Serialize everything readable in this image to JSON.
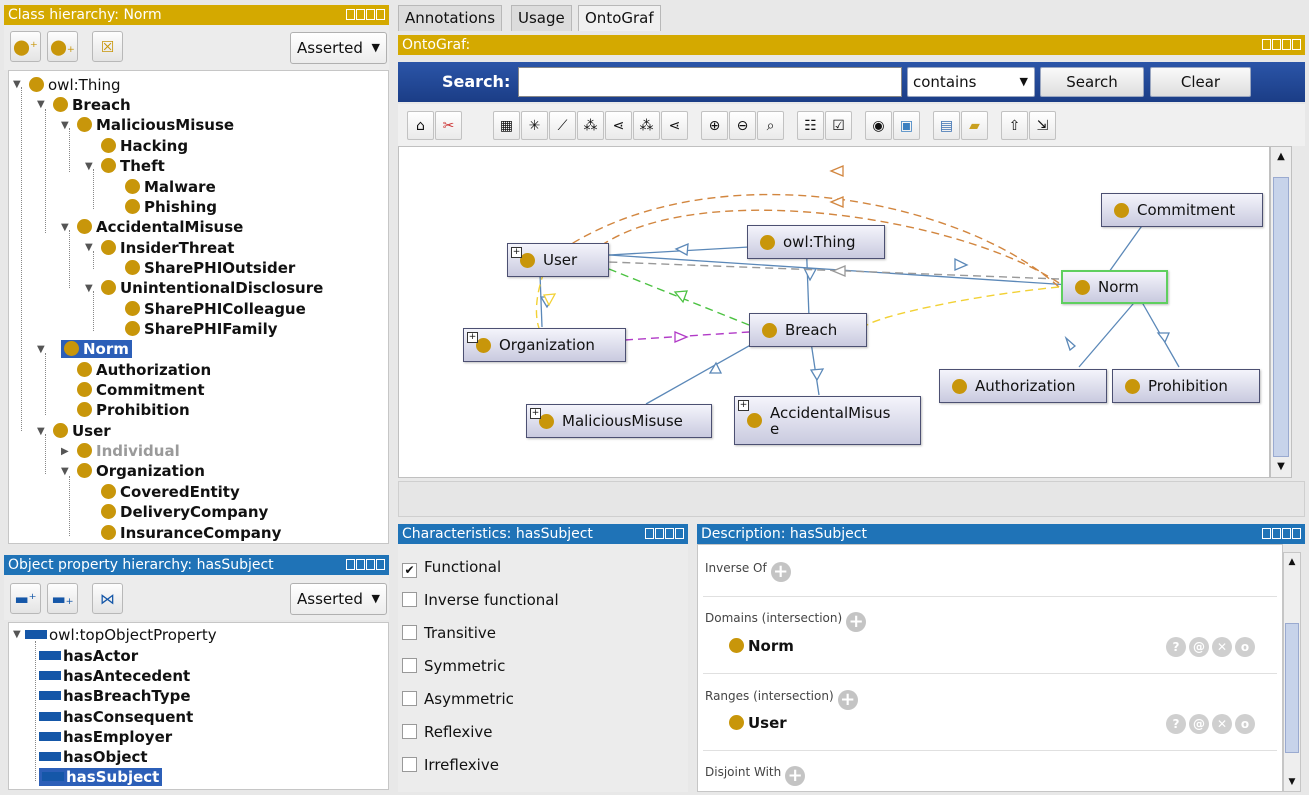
{
  "class_panel": {
    "title": "Class hierarchy: Norm",
    "mode": "Asserted",
    "tree": [
      {
        "label": "owl:Thing",
        "selected": false
      },
      {
        "label": "Breach",
        "selected": false
      },
      {
        "label": "MaliciousMisuse",
        "selected": false
      },
      {
        "label": "Hacking",
        "selected": false
      },
      {
        "label": "Theft",
        "selected": false
      },
      {
        "label": "Malware",
        "selected": false
      },
      {
        "label": "Phishing",
        "selected": false
      },
      {
        "label": "AccidentalMisuse",
        "selected": false
      },
      {
        "label": "InsiderThreat",
        "selected": false
      },
      {
        "label": "SharePHIOutsider",
        "selected": false
      },
      {
        "label": "UnintentionalDisclosure",
        "selected": false
      },
      {
        "label": "SharePHIColleague",
        "selected": false
      },
      {
        "label": "SharePHIFamily",
        "selected": false
      },
      {
        "label": "Norm",
        "selected": true
      },
      {
        "label": "Authorization",
        "selected": false
      },
      {
        "label": "Commitment",
        "selected": false
      },
      {
        "label": "Prohibition",
        "selected": false
      },
      {
        "label": "User",
        "selected": false
      },
      {
        "label": "Individual",
        "selected": false
      },
      {
        "label": "Organization",
        "selected": false
      },
      {
        "label": "CoveredEntity",
        "selected": false
      },
      {
        "label": "DeliveryCompany",
        "selected": false
      },
      {
        "label": "InsuranceCompany",
        "selected": false
      }
    ]
  },
  "property_panel": {
    "title": "Object property hierarchy: hasSubject",
    "mode": "Asserted",
    "tree": [
      {
        "label": "owl:topObjectProperty"
      },
      {
        "label": "hasActor"
      },
      {
        "label": "hasAntecedent"
      },
      {
        "label": "hasBreachType"
      },
      {
        "label": "hasConsequent"
      },
      {
        "label": "hasEmployer"
      },
      {
        "label": "hasObject"
      },
      {
        "label": "hasSubject"
      }
    ]
  },
  "tabs": [
    "Annotations",
    "Usage",
    "OntoGraf"
  ],
  "ontograf": {
    "title": "OntoGraf:",
    "search_label": "Search:",
    "search_value": "",
    "match_mode": "contains",
    "search_button": "Search",
    "clear_button": "Clear",
    "nodes": {
      "owl_thing": "owl:Thing",
      "user": "User",
      "commitment": "Commitment",
      "norm": "Norm",
      "organization": "Organization",
      "breach": "Breach",
      "authorization": "Authorization",
      "prohibition": "Prohibition",
      "malicious": "MaliciousMisuse",
      "accidental": "AccidentalMisus e"
    },
    "toolbar_icons": [
      "home-icon",
      "scissors-icon",
      "grid-layout-icon",
      "radial-layout-icon",
      "spring-layout-icon",
      "tree-layout-icon",
      "horizontal-tree-layout-icon",
      "tree-layout-2-icon",
      "horizontal-tree-layout-2-icon",
      "zoom-in-icon",
      "zoom-out-icon",
      "zoom-reset-icon",
      "filter-nodes-icon",
      "filter-arcs-icon",
      "camera-icon",
      "export-image-icon",
      "save-icon",
      "open-icon",
      "export-icon",
      "import-icon"
    ]
  },
  "characteristics": {
    "title": "Characteristics: hasSubject",
    "items": [
      {
        "label": "Functional",
        "checked": true
      },
      {
        "label": "Inverse functional",
        "checked": false
      },
      {
        "label": "Transitive",
        "checked": false
      },
      {
        "label": "Symmetric",
        "checked": false
      },
      {
        "label": "Asymmetric",
        "checked": false
      },
      {
        "label": "Reflexive",
        "checked": false
      },
      {
        "label": "Irreflexive",
        "checked": false
      }
    ]
  },
  "description": {
    "title": "Description: hasSubject",
    "inverse_of": "Inverse Of",
    "domains_label": "Domains (intersection)",
    "domain_value": "Norm",
    "ranges_label": "Ranges (intersection)",
    "range_value": "User",
    "disjoint_label": "Disjoint With"
  },
  "colors": {
    "gold": "#d4a900",
    "blue": "#1f73b7",
    "class_dot": "#c8960a",
    "selection": "#2c5fb8"
  }
}
